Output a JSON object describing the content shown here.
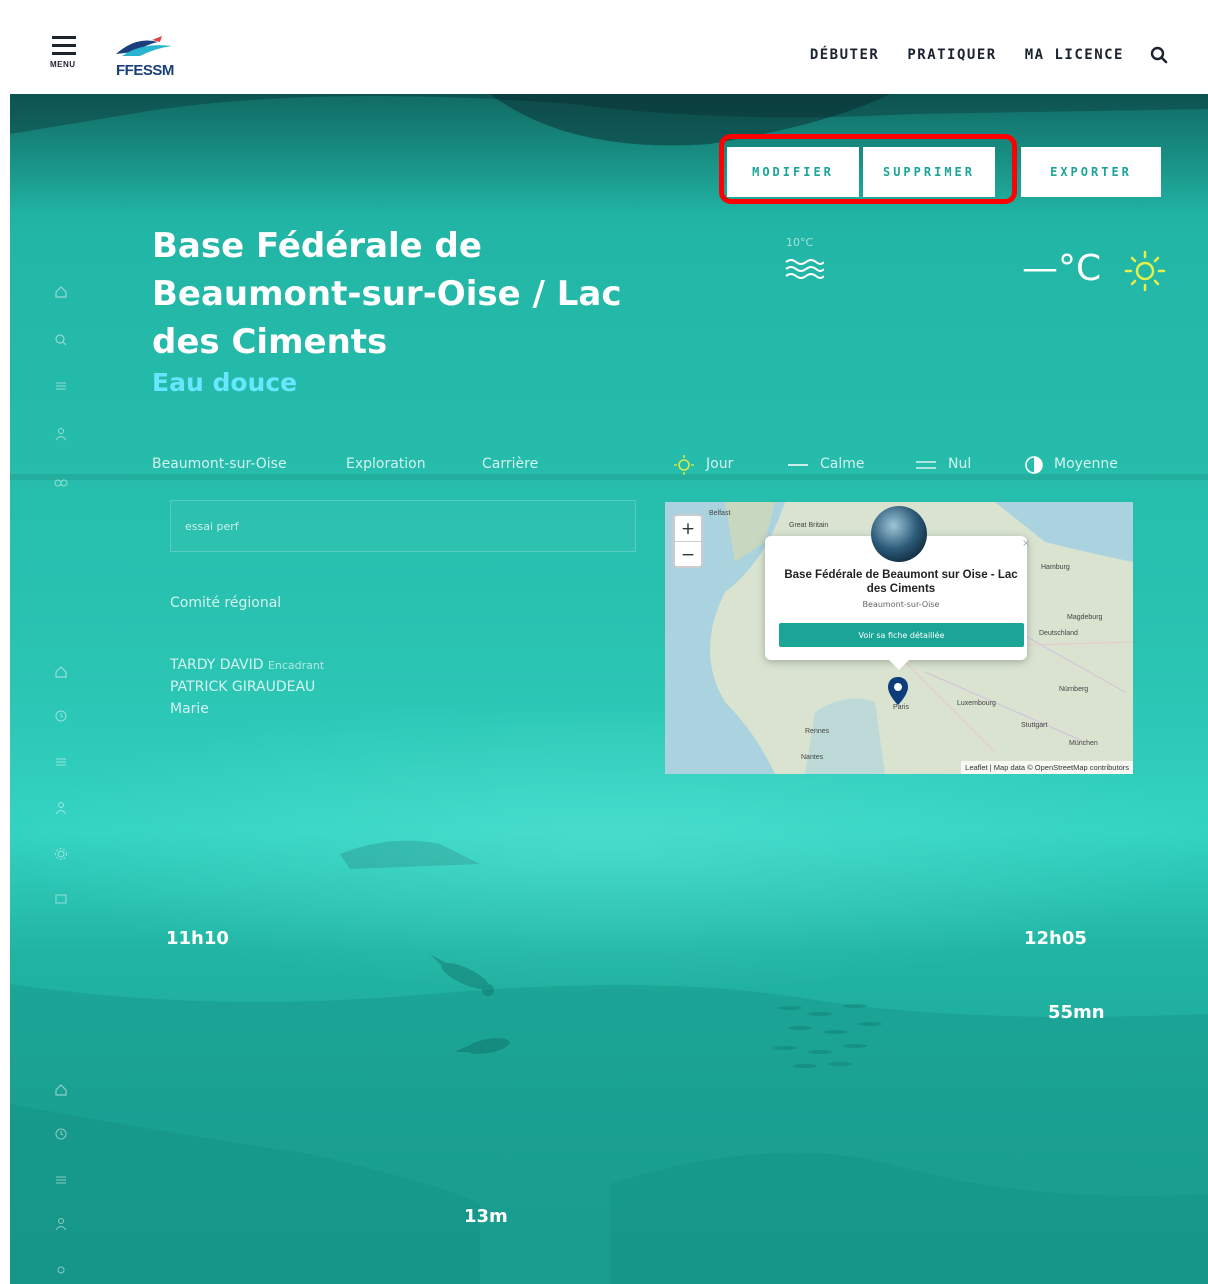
{
  "header": {
    "menu_label": "MENU",
    "logo_text": "FFESSM",
    "nav": [
      "DÉBUTER",
      "PRATIQUER",
      "MA LICENCE"
    ]
  },
  "actions": {
    "modifier": "MODIFIER",
    "supprimer": "SUPPRIMER",
    "exporter": "EXPORTER"
  },
  "site": {
    "title": "Base Fédérale de Beaumont-sur-Oise / Lac des Ciments",
    "water_type": "Eau douce"
  },
  "weather": {
    "water_temp": "10°C",
    "air_temp": "—°C"
  },
  "details": {
    "commune": "Beaumont-sur-Oise",
    "type": "Exploration",
    "milieu": "Carrière",
    "moment": "Jour",
    "etat": "Calme",
    "courant": "Nul",
    "visibilite": "Moyenne"
  },
  "search": {
    "value": "essai perf"
  },
  "structure": {
    "value": "Comité régional"
  },
  "palanquee": {
    "people": [
      {
        "name": "TARDY DAVID",
        "role": "Encadrant"
      },
      {
        "name": "PATRICK GIRAUDEAU",
        "role": ""
      },
      {
        "name": "Marie",
        "role": ""
      }
    ]
  },
  "map": {
    "popup_title": "Base Fédérale de Beaumont sur Oise - Lac des Ciments",
    "popup_sub": "Beaumont-sur-Oise",
    "popup_button": "Voir sa fiche détaillée",
    "attribution": "Leaflet | Map data © OpenStreetMap contributors",
    "labels": [
      "Great Britain",
      "Hamburg",
      "Magdeburg",
      "Deutschland",
      "Nürnberg",
      "Stuttgart",
      "München",
      "Luxembourg",
      "Paris",
      "Rennes",
      "Nantes",
      "Belfast"
    ],
    "zoom_in": "+",
    "zoom_out": "−"
  },
  "timeline": {
    "immersion": "11h10",
    "retour": "12h05",
    "duree": "55mn",
    "profondeur": "13m"
  },
  "colors": {
    "accent": "#1aa596",
    "highlight": "#ff0000",
    "subtitle": "#66e6ff"
  }
}
